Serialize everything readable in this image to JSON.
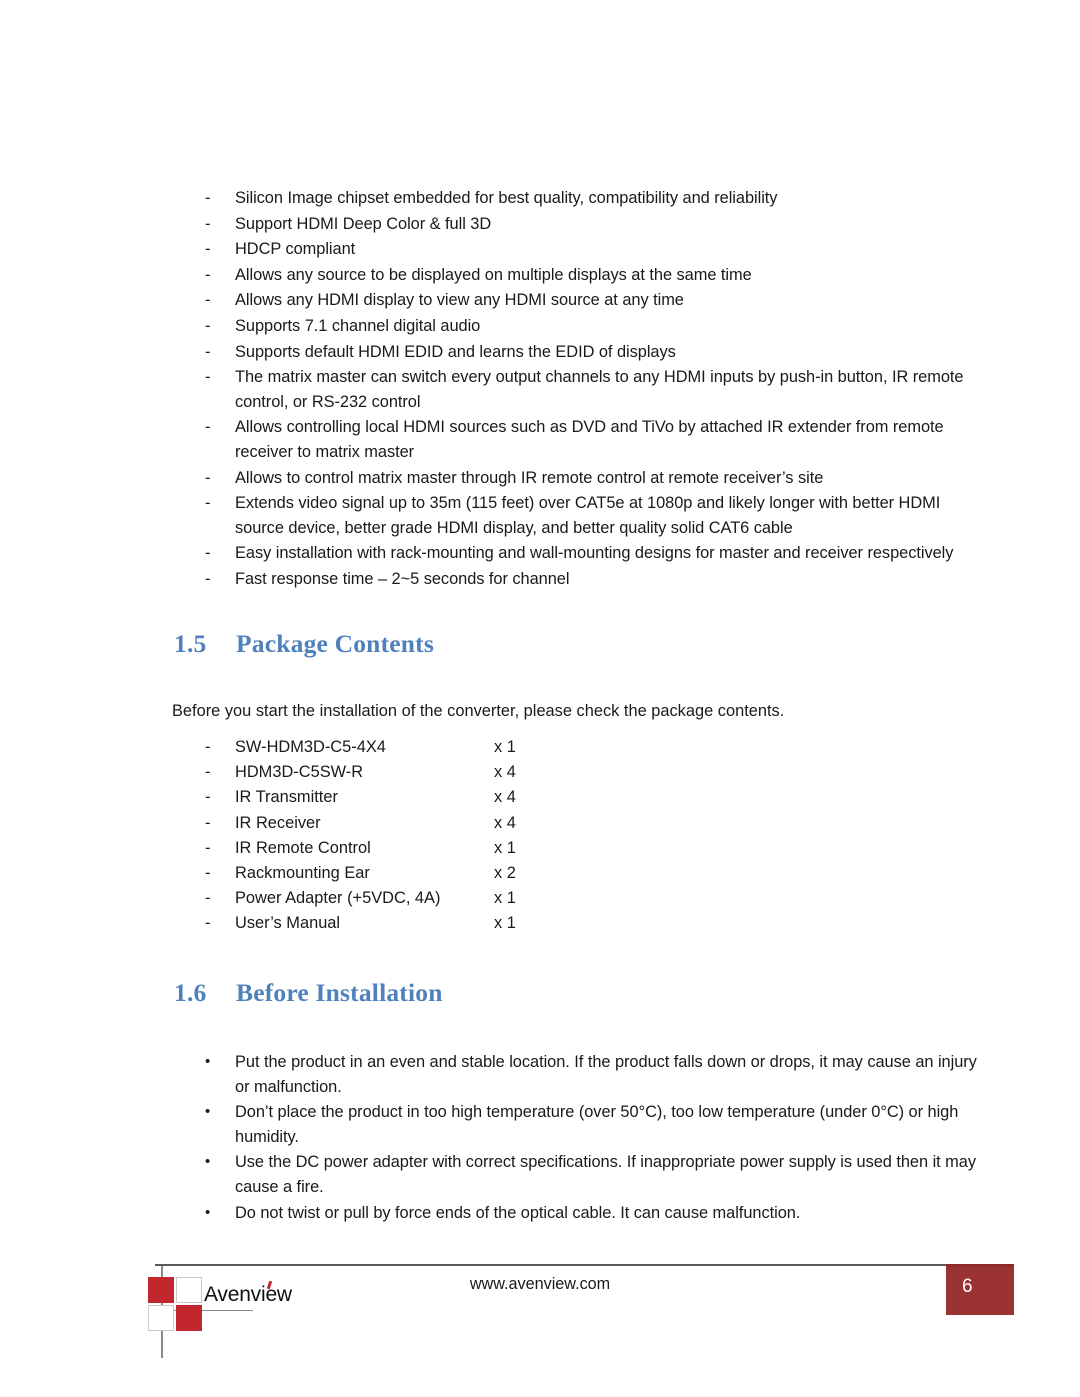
{
  "document": {
    "page_number": "6",
    "footer_url": "www.avenview.com",
    "brand_name": "Avenview",
    "accent_blue": "#4F81BD",
    "brand_red": "#C1272D",
    "page_box_red": "#9B3232"
  },
  "features": {
    "marker": "-",
    "items": [
      "Silicon Image chipset embedded for best quality, compatibility and reliability",
      "Support HDMI Deep Color & full 3D",
      "HDCP compliant",
      "Allows any source to be displayed on multiple displays at the same time",
      "Allows any HDMI display to view any HDMI source at any time",
      "Supports 7.1 channel digital audio",
      "Supports default HDMI EDID and learns the EDID of displays",
      "The matrix master can switch every output channels to any HDMI inputs by push-in button, IR remote control, or RS-232 control",
      "Allows controlling local HDMI sources such as DVD and TiVo by attached IR extender from remote receiver to matrix master",
      "Allows to control matrix master through IR remote control at remote receiver’s site",
      "Extends video signal up to 35m (115 feet) over CAT5e at 1080p and likely longer with better HDMI source device, better grade HDMI display, and better quality solid CAT6 cable",
      "Easy installation with rack-mounting and wall-mounting designs for master and receiver respectively",
      "Fast response time – 2~5 seconds for channel"
    ]
  },
  "section_package": {
    "number": "1.5",
    "title": "Package Contents",
    "intro": "Before you start the installation of the converter, please check the package contents.",
    "marker": "-",
    "items": [
      {
        "name": "SW-HDM3D-C5-4X4",
        "qty": "x 1"
      },
      {
        "name": "HDM3D-C5SW-R",
        "qty": "x 4"
      },
      {
        "name": "IR Transmitter",
        "qty": "x 4"
      },
      {
        "name": "IR Receiver",
        "qty": "x 4"
      },
      {
        "name": "IR Remote Control",
        "qty": "x 1"
      },
      {
        "name": "Rackmounting Ear",
        "qty": "x 2"
      },
      {
        "name": "Power Adapter (+5VDC, 4A)",
        "qty": "x 1"
      },
      {
        "name": "User’s Manual",
        "qty": "x 1"
      }
    ]
  },
  "section_before_install": {
    "number": "1.6",
    "title": "Before Installation",
    "marker": "•",
    "items": [
      "Put the product in an even and stable location. If the product falls down or drops, it may cause an injury or malfunction.",
      "Don’t place the product in too high temperature (over 50°C), too low temperature (under 0°C) or high humidity.",
      "Use the DC power adapter with correct specifications. If inappropriate power supply is used then it may cause a fire.",
      "Do not twist or pull by force ends of the optical cable. It can cause malfunction."
    ]
  }
}
